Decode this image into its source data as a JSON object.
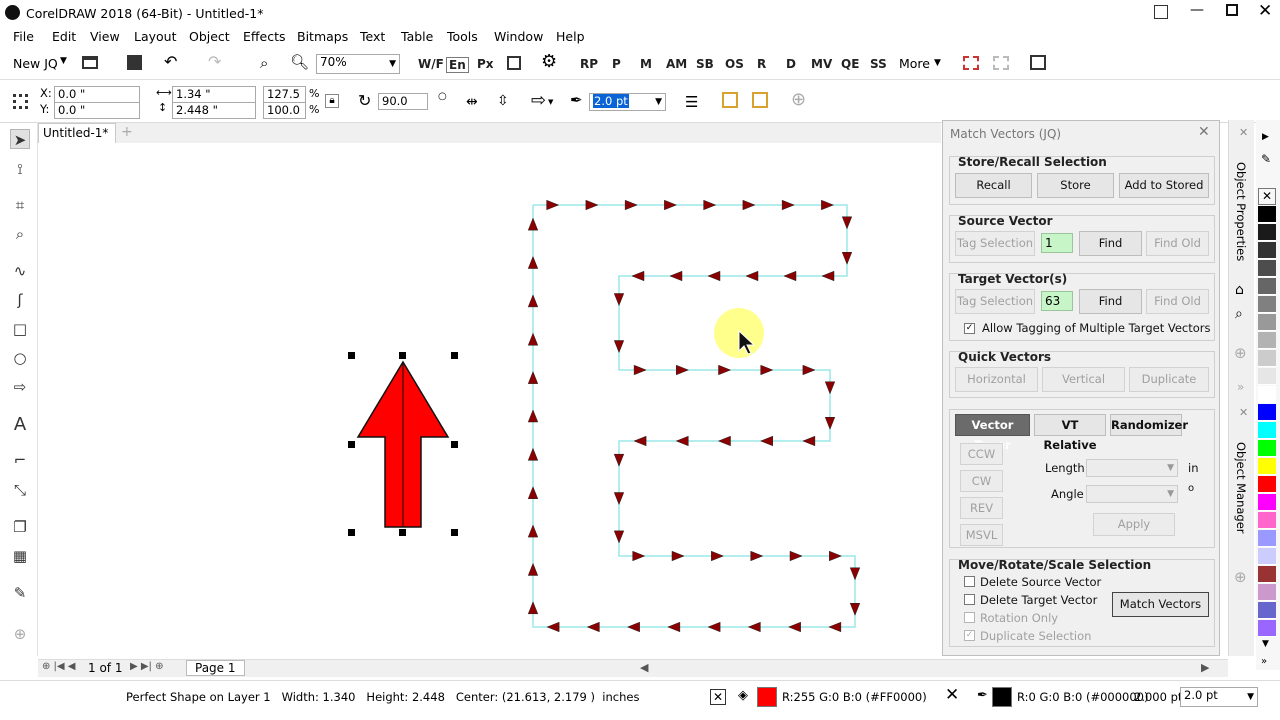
{
  "titlebar": {
    "title": "CorelDRAW 2018 (64-Bit) - Untitled-1*"
  },
  "menu": [
    "File",
    "Edit",
    "View",
    "Layout",
    "Object",
    "Effects",
    "Bitmaps",
    "Text",
    "Table",
    "Tools",
    "Window",
    "Help"
  ],
  "toolbar1": {
    "new_label": "New JQ",
    "zoom_value": "70%",
    "macro_buttons": [
      "W/F",
      "En",
      "Px",
      "RP",
      "P",
      "M",
      "AM",
      "OS",
      "SB",
      "OS",
      "R",
      "D",
      "MV",
      "QE",
      "SS"
    ],
    "more_label": "More"
  },
  "toolbar2": {
    "x": "0.0 \"",
    "y": "0.0 \"",
    "w": "1.34 \"",
    "h": "2.448 \"",
    "scale_w": "127.5",
    "scale_h": "100.0",
    "pct": "%",
    "angle": "90.0",
    "outline": "2.0 pt"
  },
  "doc_tab": "Untitled-1*",
  "pagebar": {
    "page_of": "1 of 1",
    "page_tab": "Page 1"
  },
  "status": {
    "info": "Perfect Shape on Layer 1   Width: 1.340   Height: 2.448   Center: (21.613, 2.179 )  inches",
    "fill": "R:255 G:0 B:0 (#FF0000)",
    "outline": "R:0 G:0 B:0 (#000000)",
    "outline_width": "2.000 pt",
    "outline_select": "2.0 pt"
  },
  "docker": {
    "title": "Match Vectors (JQ)",
    "store": {
      "title": "Store/Recall Selection",
      "recall": "Recall",
      "store": "Store",
      "add": "Add to Stored"
    },
    "source": {
      "title": "Source Vector",
      "tag": "Tag Selection",
      "value": "1",
      "find": "Find",
      "find_old": "Find Old"
    },
    "target": {
      "title": "Target Vector(s)",
      "tag": "Tag Selection",
      "value": "63",
      "find": "Find",
      "find_old": "Find Old",
      "allow": "Allow Tagging of Multiple Target Vectors"
    },
    "quick": {
      "title": "Quick Vectors",
      "h": "Horizontal",
      "v": "Vertical",
      "d": "Duplicate"
    },
    "tuner": {
      "tab1": "Vector Tuner",
      "tab2": "VT Relative",
      "tab3": "Randomizer",
      "ccw": "CCW",
      "cw": "CW",
      "rev": "REV",
      "msvl": "MSVL",
      "length": "Length",
      "length_unit": "in",
      "angle": "Angle",
      "angle_unit": "o",
      "apply": "Apply"
    },
    "move": {
      "title": "Move/Rotate/Scale Selection",
      "del_src": "Delete Source Vector",
      "del_tgt": "Delete Target Vector",
      "rot_only": "Rotation Only",
      "dup_sel": "Duplicate Selection",
      "match": "Match Vectors"
    }
  },
  "side_tabs": {
    "t1": "Object Properties",
    "t2": "Object Manager"
  },
  "palette": [
    "#ffffff",
    "#000000",
    "#1a1a1a",
    "#333333",
    "#4d4d4d",
    "#666666",
    "#808080",
    "#999999",
    "#b3b3b3",
    "#cccccc",
    "#e6e6e6",
    "#ffffff",
    "#0000ff",
    "#00ffff",
    "#00ff00",
    "#ffff00",
    "#ff0000",
    "#ff00ff",
    "#ff66cc",
    "#9999ff",
    "#ccccff",
    "#993333",
    "#cc99cc",
    "#6666cc",
    "#9966ff"
  ],
  "colors": {
    "arrow_fill": "#ff0000",
    "path_stroke": "#9be7e7",
    "marker": "#8b0000"
  }
}
